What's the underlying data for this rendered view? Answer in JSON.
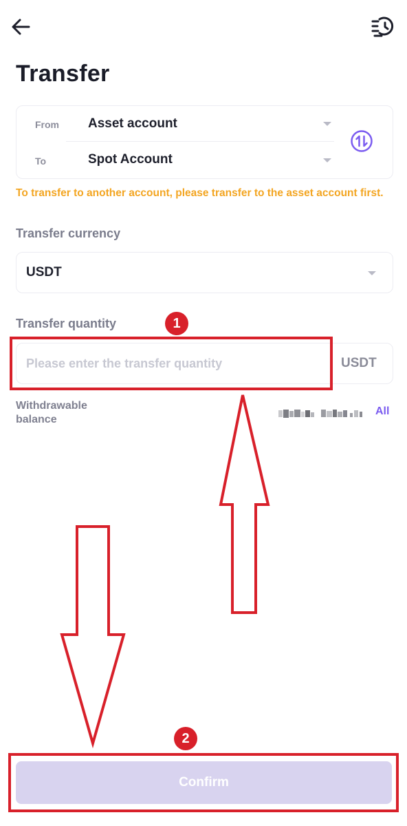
{
  "header": {
    "back_icon": "arrow-left-icon",
    "history_icon": "history-list-icon",
    "title": "Transfer"
  },
  "accounts": {
    "from_label": "From",
    "from_value": "Asset account",
    "to_label": "To",
    "to_value": "Spot Account",
    "swap_icon": "swap-arrows-icon"
  },
  "warning": "To transfer to another account, please transfer to the asset account first.",
  "currency": {
    "label": "Transfer currency",
    "value": "USDT"
  },
  "quantity": {
    "label": "Transfer quantity",
    "placeholder": "Please enter the transfer quantity",
    "value": "",
    "unit": "USDT"
  },
  "balance": {
    "label_line1": "Withdrawable",
    "label_line2": "balance",
    "all_label": "All"
  },
  "confirm_label": "Confirm",
  "annotations": {
    "step1": "1",
    "step2": "2",
    "color": "#d8202a"
  },
  "colors": {
    "warning": "#f3a521",
    "accent": "#7b5cf0",
    "button_disabled": "#d8d3ef"
  }
}
